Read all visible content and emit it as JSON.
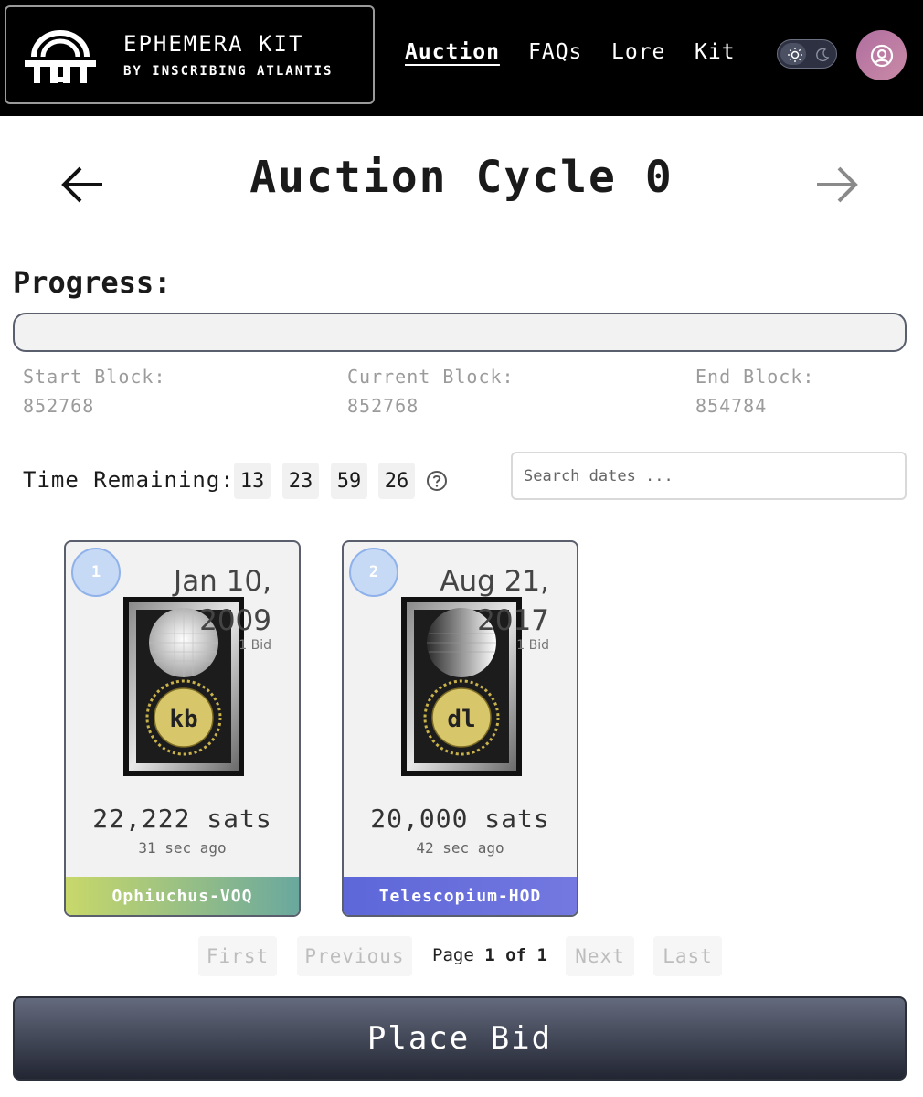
{
  "header": {
    "brand_title": "EPHEMERA KIT",
    "brand_subtitle": "BY INSCRIBING ATLANTIS",
    "nav": [
      "Auction",
      "FAQs",
      "Lore",
      "Kit"
    ],
    "active_nav": "Auction",
    "theme_toggle": {
      "options": [
        "sun-icon",
        "moon-icon"
      ],
      "selected": "sun-icon"
    },
    "avatar_icon": "user-circle-icon"
  },
  "title": "Auction Cycle 0",
  "progress": {
    "label": "Progress:",
    "fraction": 0.0,
    "start_label": "Start Block:",
    "start_value": "852768",
    "current_label": "Current Block:",
    "current_value": "852768",
    "end_label": "End Block:",
    "end_value": "854784"
  },
  "time": {
    "label": "Time Remaining:",
    "values": [
      "13",
      "23",
      "59",
      "26"
    ]
  },
  "search": {
    "placeholder": "Search dates ..."
  },
  "cards": [
    {
      "rank": "1",
      "date_line1": "Jan 10,",
      "date_line2": "2009",
      "bids": "1 Bid",
      "sats": "22,222 sats",
      "time_ago": "31 sec ago",
      "name": "Ophiuchus-VOQ",
      "gradient": [
        "#c8d86a",
        "#6aa89e"
      ]
    },
    {
      "rank": "2",
      "date_line1": "Aug 21,",
      "date_line2": "2017",
      "bids": "1 Bid",
      "sats": "20,000 sats",
      "time_ago": "42 sec ago",
      "name": "Telescopium-HOD",
      "gradient": [
        "#5d67d8",
        "#7478e0"
      ]
    }
  ],
  "pagination": {
    "first": "First",
    "previous": "Previous",
    "page_word": "Page",
    "current": "1",
    "of_word": "of",
    "total": "1",
    "next": "Next",
    "last": "Last"
  },
  "place_bid": "Place Bid",
  "colors": {
    "header_bg": "#000000",
    "accent_dark": "#2d3142",
    "muted_text": "#9b9b9b"
  }
}
